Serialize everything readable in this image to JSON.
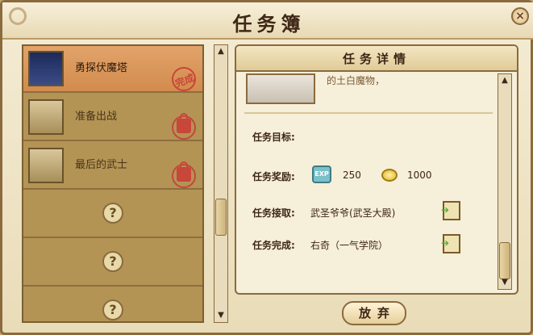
{
  "window": {
    "title": "任务簿",
    "close_label": "×"
  },
  "quests": [
    {
      "name": "勇探伏魔塔",
      "status": "完成",
      "state": "done"
    },
    {
      "name": "准备出战",
      "state": "locked"
    },
    {
      "name": "最后的武士",
      "state": "locked"
    }
  ],
  "empty_slot_mark": "?",
  "list_scroll": {
    "up": "▲",
    "down": "▼"
  },
  "detail": {
    "title": "任务详情",
    "partial_text": "的土白魔物，",
    "goal_label": "任务目标:",
    "goal_value": "",
    "reward_label": "任务奖励:",
    "exp_icon_text": "EXP",
    "exp_value": "250",
    "gold_value": "1000",
    "accept_label": "任务接取:",
    "accept_value": "武圣爷爷(武圣大殿)",
    "complete_label": "任务完成:",
    "complete_value": "右奇（一气学院）",
    "scroll": {
      "up": "▲",
      "down": "▼"
    }
  },
  "abandon_label": "放弃"
}
